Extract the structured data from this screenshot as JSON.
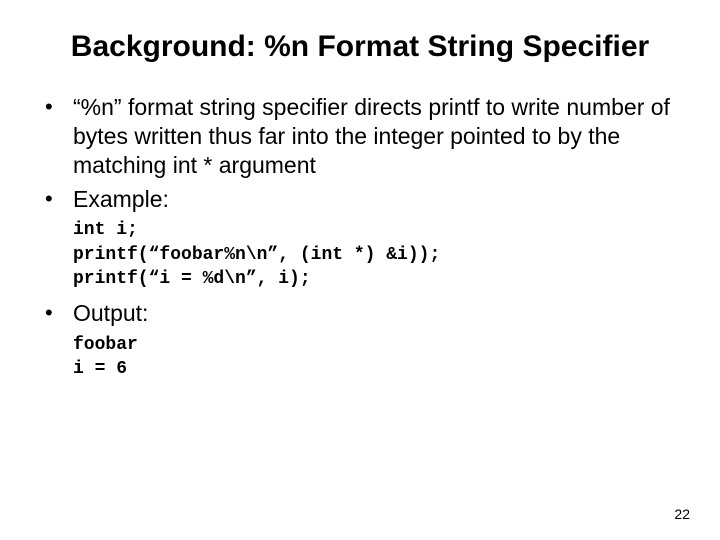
{
  "title": "Background: %n Format String Specifier",
  "bullets": {
    "b1": "“%n” format string specifier directs printf to write number of bytes written thus far into the integer pointed to by the matching int * argument",
    "b2": "Example:",
    "b3": "Output:"
  },
  "code": {
    "example": "int i;\nprintf(“foobar%n\\n”, (int *) &i));\nprintf(“i = %d\\n”, i);",
    "output": "foobar\ni = 6"
  },
  "page_number": "22"
}
